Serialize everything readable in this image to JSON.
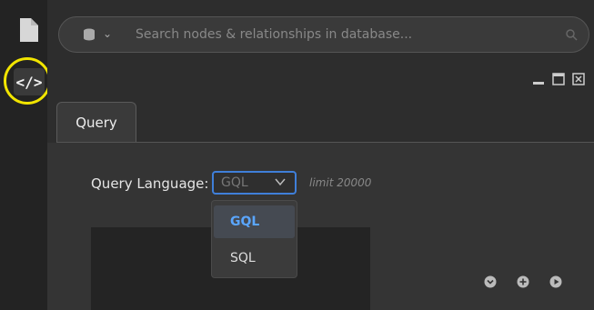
{
  "search": {
    "placeholder": "Search nodes & relationships in database..."
  },
  "tabs": [
    {
      "label": "Query"
    }
  ],
  "query": {
    "language_label": "Query Language:",
    "selected_language": "GQL",
    "limit_text": "limit 20000",
    "language_options": [
      "GQL",
      "SQL"
    ]
  },
  "colors": {
    "accent": "#3f7fd9",
    "selected_option": "#5aa6ff",
    "highlight_ring": "#f2e500"
  },
  "icons": [
    "file-icon",
    "code-icon",
    "database-icon",
    "search-icon",
    "minimize-icon",
    "maximize-icon",
    "close-icon",
    "chevron-down-icon",
    "expand-down-icon",
    "add-icon",
    "run-icon"
  ]
}
